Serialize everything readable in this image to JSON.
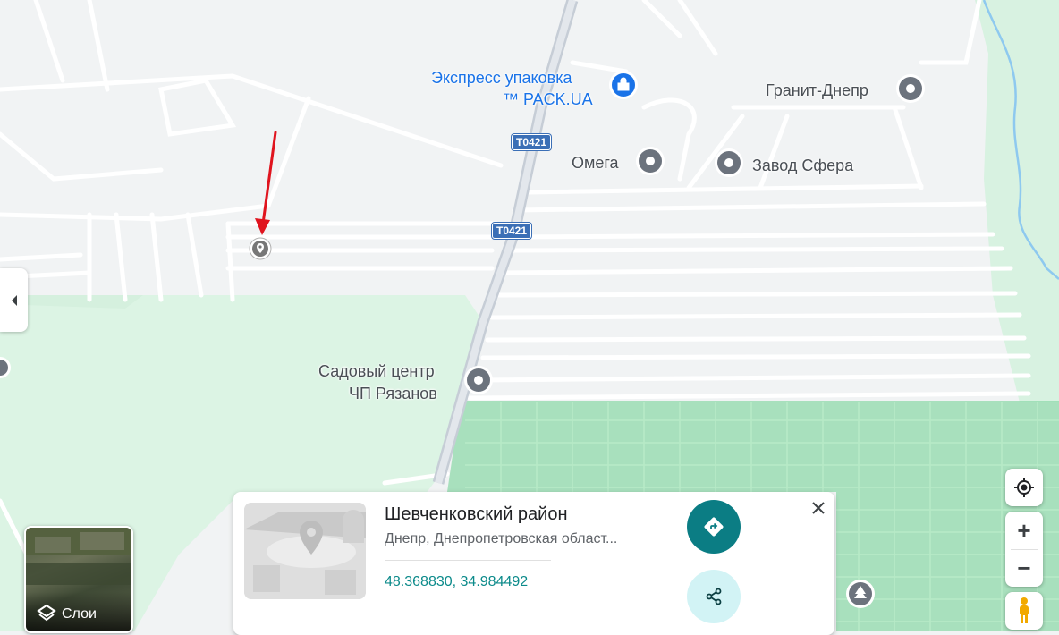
{
  "map": {
    "pois": [
      {
        "id": "express",
        "lines": [
          "Экспресс упаковка",
          "™ PACK.UA"
        ],
        "color": "#1a73e8"
      },
      {
        "id": "granit",
        "lines": [
          "Гранит-Днепр"
        ],
        "color": "#5f6368"
      },
      {
        "id": "omega",
        "lines": [
          "Омега"
        ],
        "color": "#5f6368"
      },
      {
        "id": "sfera",
        "lines": [
          "Завод Сфера"
        ],
        "color": "#5f6368"
      },
      {
        "id": "sad",
        "lines": [
          "Садовый центр",
          "ЧП Рязанов"
        ],
        "color": "#5f6368"
      }
    ],
    "road_shields": [
      "T0421",
      "T0421"
    ],
    "colors": {
      "background": "#f1f3f4",
      "road": "#ffffff",
      "park": "#d9f2e2",
      "park_dark": "#8fd9ab",
      "water": "#8ec9ef",
      "highway": "#c6cdd6",
      "arrow": "#e0141e"
    }
  },
  "layers_button": {
    "label": "Слои",
    "icon": "layers-icon"
  },
  "place_card": {
    "title": "Шевченковский район",
    "subtitle": "Днепр, Днепропетровская област...",
    "coords": "48.368830, 34.984492",
    "directions_icon": "directions-icon",
    "share_icon": "share-icon",
    "close_icon": "close-icon"
  },
  "controls": {
    "locate_icon": "my-location-icon",
    "zoom_in": "+",
    "zoom_out": "−",
    "pegman_icon": "pegman-icon",
    "collapse_icon": "chevron-left-icon"
  }
}
